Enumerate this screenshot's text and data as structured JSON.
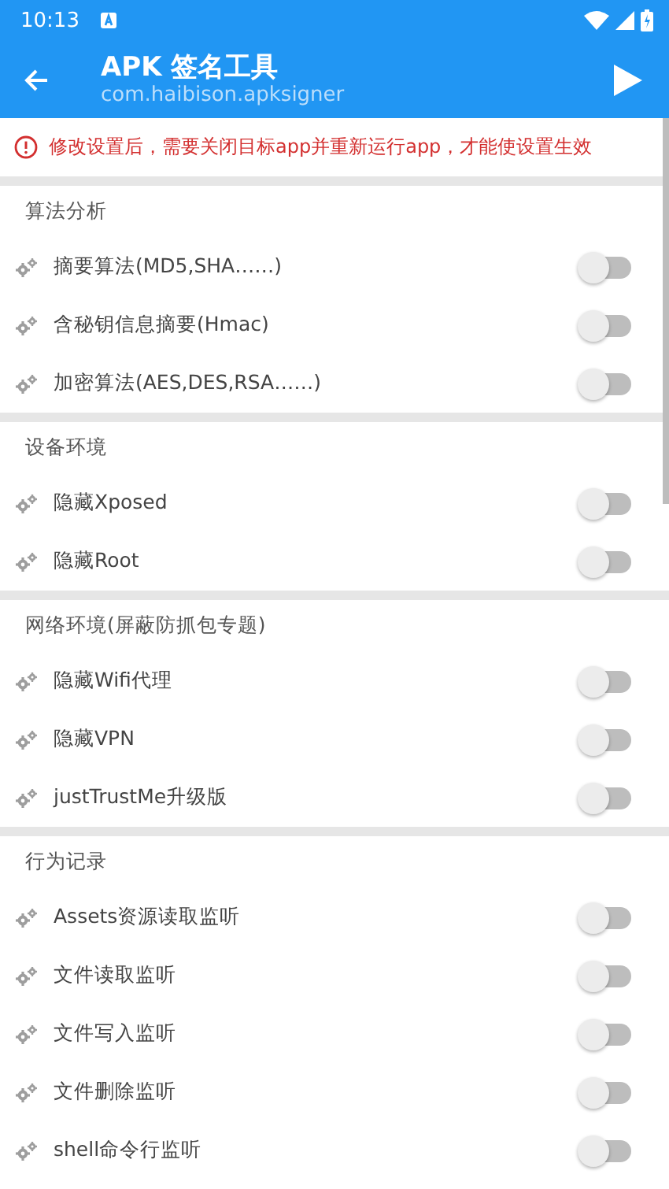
{
  "status_bar": {
    "time": "10:13"
  },
  "app_bar": {
    "title": "APK 签名工具",
    "subtitle": "com.haibison.apksigner"
  },
  "notice": "修改设置后，需要关闭目标app并重新运行app，才能使设置生效",
  "sections": [
    {
      "title": "算法分析",
      "items": [
        {
          "label": "摘要算法(MD5,SHA……)",
          "on": false
        },
        {
          "label": "含秘钥信息摘要(Hmac)",
          "on": false
        },
        {
          "label": "加密算法(AES,DES,RSA……)",
          "on": false
        }
      ]
    },
    {
      "title": "设备环境",
      "items": [
        {
          "label": "隐藏Xposed",
          "on": false
        },
        {
          "label": "隐藏Root",
          "on": false
        }
      ]
    },
    {
      "title": "网络环境(屏蔽防抓包专题)",
      "items": [
        {
          "label": "隐藏Wifi代理",
          "on": false
        },
        {
          "label": "隐藏VPN",
          "on": false
        },
        {
          "label": "justTrustMe升级版",
          "on": false
        }
      ]
    },
    {
      "title": "行为记录",
      "items": [
        {
          "label": "Assets资源读取监听",
          "on": false
        },
        {
          "label": "文件读取监听",
          "on": false
        },
        {
          "label": "文件写入监听",
          "on": false
        },
        {
          "label": "文件删除监听",
          "on": false
        },
        {
          "label": "shell命令行监听",
          "on": false
        }
      ]
    }
  ]
}
